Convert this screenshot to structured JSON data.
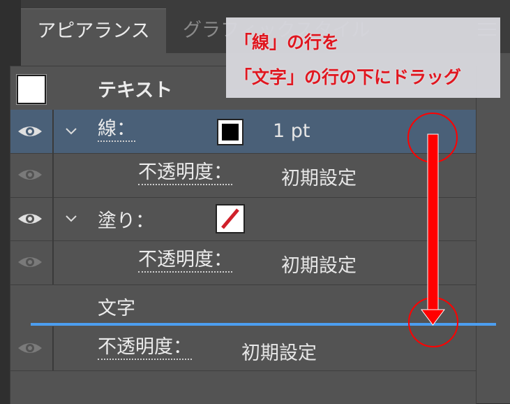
{
  "tabs": {
    "appearance": "アピアランス",
    "graphic_style": "グラフィックスタイル"
  },
  "rows": {
    "header_label": "テキスト",
    "stroke_label": "線：",
    "stroke_value": "1 pt",
    "stroke_opacity_label": "不透明度：",
    "stroke_opacity_value": "初期設定",
    "fill_label": "塗り：",
    "fill_opacity_label": "不透明度：",
    "fill_opacity_value": "初期設定",
    "characters_label": "文字",
    "text_opacity_label": "不透明度：",
    "text_opacity_value": "初期設定"
  },
  "annotation": {
    "line1": "「線」の行を",
    "line2": "「文字」の行の下にドラッグ",
    "color": "#e8141e"
  },
  "colors": {
    "panel_bg": "#535353",
    "selected_row": "#4a6078",
    "drop_indicator": "#4c9ef0",
    "arrow": "#ff0000"
  }
}
